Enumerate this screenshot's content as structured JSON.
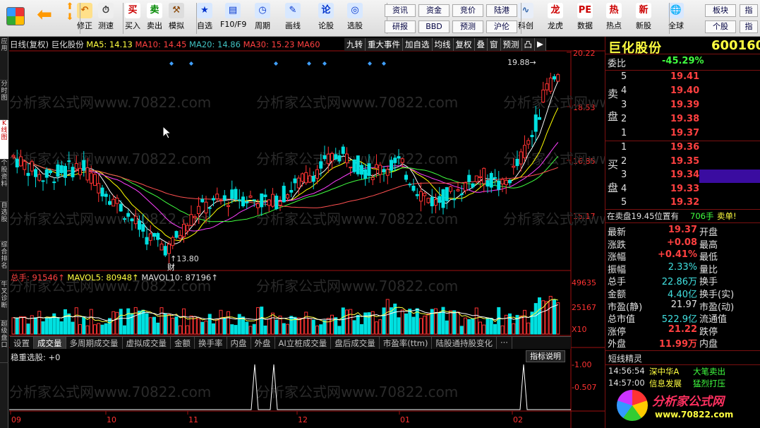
{
  "toolbar": {
    "buttons": [
      {
        "label": "修正",
        "icon": "↶"
      },
      {
        "label": "测速",
        "icon": "⏱"
      },
      {
        "label": "买入",
        "icon": "买"
      },
      {
        "label": "卖出",
        "icon": "卖"
      },
      {
        "label": "模拟",
        "icon": "⚒"
      },
      {
        "label": "自选",
        "icon": "★"
      },
      {
        "label": "F10/F9",
        "icon": "▤"
      },
      {
        "label": "周期",
        "icon": "◷"
      },
      {
        "label": "画线",
        "icon": "✎"
      },
      {
        "label": "论股",
        "icon": "论"
      },
      {
        "label": "选股",
        "icon": "◎"
      },
      {
        "label": "科创",
        "icon": "∿"
      },
      {
        "label": "龙虎",
        "icon": "龙"
      },
      {
        "label": "数据",
        "icon": "PE"
      },
      {
        "label": "热点",
        "icon": "热"
      },
      {
        "label": "新股",
        "icon": "新"
      },
      {
        "label": "全球",
        "icon": "🌐"
      }
    ],
    "text_buttons": [
      [
        "资讯",
        "研报"
      ],
      [
        "资金",
        "BBD"
      ],
      [
        "竞价",
        "预测"
      ],
      [
        "陆港",
        "沪伦"
      ],
      [
        "板块",
        "个股"
      ],
      [
        "指",
        "指"
      ]
    ]
  },
  "left_tabs": [
    "应用",
    "分时图",
    "K线图",
    "个股资料",
    "自选股",
    "综合排名",
    "牛叉诊断",
    "超级盘口"
  ],
  "chart": {
    "info": {
      "period": "日线(复权)",
      "name": "巨化股份",
      "ma5": "MA5: 14.13",
      "ma10": "MA10: 14.45",
      "ma20": "MA20: 14.86",
      "ma30": "MA30: 15.23",
      "ma60": "MA60"
    },
    "menu": [
      "九转",
      "重大事件",
      "加自选",
      "均线",
      "复权",
      "叠",
      "窗",
      "预测",
      "凸",
      "▶"
    ],
    "price_ticks": [
      "20.22",
      "18.53",
      "16.85",
      "15.17"
    ],
    "high_label": "19.88",
    "low_label": "13.80",
    "fin_mark": "财",
    "vol_info": {
      "total": "总手: 91546↑",
      "mavol5": "MAVOL5: 80948↑",
      "mavol10": "MAVOL10: 87196↑"
    },
    "vol_ticks": [
      "49635",
      "25167",
      "X10"
    ],
    "tabs": [
      "设置",
      "成交量",
      "多周期成交量",
      "虚拟成交量",
      "金额",
      "换手率",
      "内盘",
      "外盘",
      "AI立桩成交量",
      "盘后成交量",
      "市盈率(ttm)",
      "陆股通持股变化",
      "···"
    ],
    "indicator": "稳重选股: +0",
    "indicator_btn": "指标说明",
    "ind_ticks": [
      "1.00",
      "0.507"
    ],
    "months": [
      "09",
      "10",
      "11",
      "12",
      "01",
      "02"
    ],
    "watermark": "分析家公式网www.70822.com",
    "colors": {
      "up": "#ff3232",
      "down": "#00e0e0",
      "ma5": "#ffffff",
      "ma10": "#ffff00",
      "ma20": "#ff40ff",
      "ma30": "#40ff40",
      "ma60": "#ff5050"
    }
  },
  "quote": {
    "name": "巨化股份",
    "code": "600160",
    "mark": "R",
    "weibi_label": "委比",
    "weibi": "-45.29%",
    "sell_label": [
      "卖",
      "盘"
    ],
    "buy_label": [
      "买",
      "盘"
    ],
    "asks": [
      {
        "n": "5",
        "p": "19.41"
      },
      {
        "n": "4",
        "p": "19.40"
      },
      {
        "n": "3",
        "p": "19.39"
      },
      {
        "n": "2",
        "p": "19.38"
      },
      {
        "n": "1",
        "p": "19.37"
      }
    ],
    "bids": [
      {
        "n": "1",
        "p": "19.36"
      },
      {
        "n": "2",
        "p": "19.35"
      },
      {
        "n": "3",
        "p": "19.34"
      },
      {
        "n": "4",
        "p": "19.33"
      },
      {
        "n": "5",
        "p": "19.32"
      }
    ],
    "notice": {
      "text": "在卖盘19.45位置有",
      "qty": "706手",
      "tail": "卖单!"
    },
    "stats": [
      [
        "最新",
        "19.37",
        "开盘",
        ""
      ],
      [
        "涨跌",
        "+0.08",
        "最高",
        ""
      ],
      [
        "涨幅",
        "+0.41%",
        "最低",
        ""
      ],
      [
        "振幅",
        "2.33%",
        "量比",
        ""
      ],
      [
        "总手",
        "22.86万",
        "换手",
        ""
      ],
      [
        "金额",
        "4.40亿",
        "换手(实)",
        ""
      ],
      [
        "市盈(静)",
        "21.97",
        "市盈(动)",
        ""
      ],
      [
        "总市值",
        "522.9亿",
        "流通值",
        ""
      ],
      [
        "涨停",
        "21.22",
        "跌停",
        ""
      ],
      [
        "外盘",
        "11.99万",
        "内盘",
        ""
      ]
    ],
    "elf": {
      "title": "短线精灵",
      "rows": [
        [
          "14:56:54",
          "深中华A",
          "大笔卖出"
        ],
        [
          "14:57:00",
          "信息发展",
          "猛烈打压"
        ]
      ]
    },
    "logo": {
      "text": "分析家公式网",
      "url": "www.70822.com"
    }
  }
}
